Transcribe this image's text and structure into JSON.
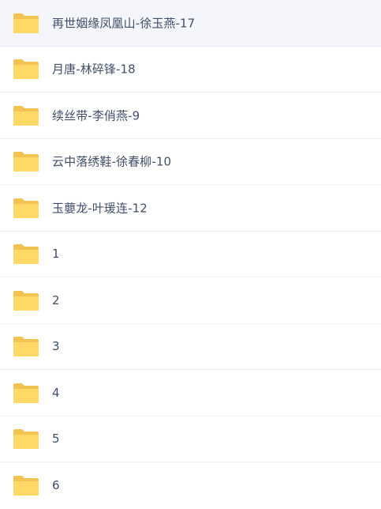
{
  "colors": {
    "folder_back": "#f3c351",
    "folder_front": "#ffd866",
    "text": "#424e67",
    "selected_row": "#f4f6fb",
    "divider": "#eef1f6"
  },
  "folders": [
    {
      "name": "再世姻缘凤凰山-徐玉燕-17",
      "icon": "folder-icon",
      "selected": true
    },
    {
      "name": "月唐-林碎锋-18",
      "icon": "folder-icon",
      "selected": false
    },
    {
      "name": "续丝带-李俏燕-9",
      "icon": "folder-icon",
      "selected": false
    },
    {
      "name": "云中落绣鞋-徐春柳-10",
      "icon": "folder-icon",
      "selected": false
    },
    {
      "name": "玉蘡龙-叶瑗连-12",
      "icon": "folder-icon",
      "selected": false
    },
    {
      "name": "1",
      "icon": "folder-icon",
      "selected": false
    },
    {
      "name": "2",
      "icon": "folder-icon",
      "selected": false
    },
    {
      "name": "3",
      "icon": "folder-icon",
      "selected": false
    },
    {
      "name": "4",
      "icon": "folder-icon",
      "selected": false
    },
    {
      "name": "5",
      "icon": "folder-icon",
      "selected": false
    },
    {
      "name": "6",
      "icon": "folder-icon",
      "selected": false
    }
  ]
}
